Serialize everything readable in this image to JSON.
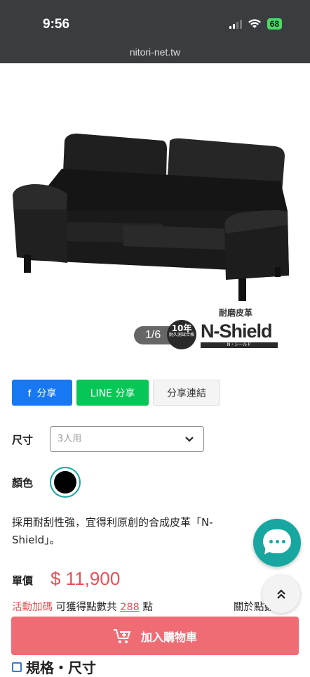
{
  "status_bar": {
    "time": "9:56",
    "battery": "68",
    "url": "nitori-net.tw"
  },
  "gallery": {
    "counter": "1/6",
    "badge_main": "10年",
    "badge_sub": "耐久測試合格",
    "brand_caption": "耐磨皮革",
    "brand_logo": "N-Shield",
    "brand_sub": "N・シールド"
  },
  "share": {
    "facebook_icon": "f",
    "facebook": "分享",
    "line": "LINE 分享",
    "link": "分享連結"
  },
  "options": {
    "size_label": "尺寸",
    "size_placeholder": "3人用",
    "color_label": "顏色",
    "color_value": "#000000"
  },
  "description": "採用耐刮性強，宜得利原創的合成皮革「N-Shield」。",
  "price": {
    "label": "單價",
    "value": "$ 11,900"
  },
  "points": {
    "promo": "活動加碼",
    "text_before": "可獲得點數共",
    "amount": "288",
    "text_after": "點",
    "about": "關於點數"
  },
  "cart": {
    "label": "加入購物車"
  },
  "spec": {
    "heading": "規格・尺寸"
  },
  "colors": {
    "accent": "#18a7a0",
    "price": "#e94f57",
    "cart": "#f06c75",
    "facebook": "#1877f2",
    "line": "#06c755"
  }
}
